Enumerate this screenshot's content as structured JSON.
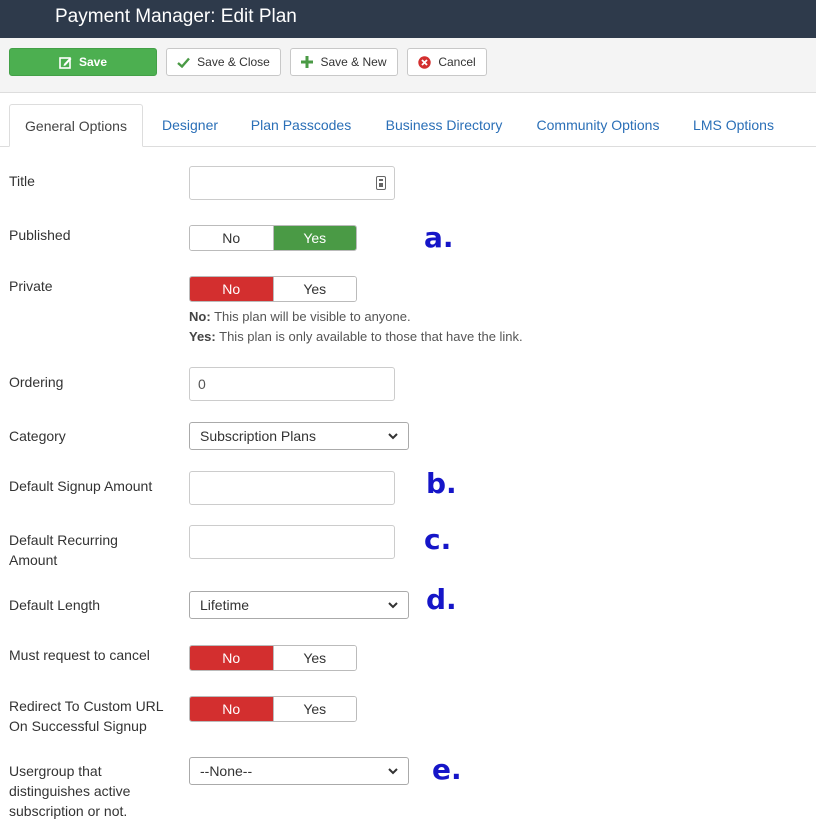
{
  "header": {
    "title": "Payment Manager: Edit Plan"
  },
  "toolbar": {
    "save": "Save",
    "save_close": "Save & Close",
    "save_new": "Save & New",
    "cancel": "Cancel"
  },
  "tabs": [
    "General Options",
    "Designer",
    "Plan Passcodes",
    "Business Directory",
    "Community Options",
    "LMS Options"
  ],
  "form": {
    "title": {
      "label": "Title",
      "value": ""
    },
    "published": {
      "label": "Published",
      "no": "No",
      "yes": "Yes",
      "selected": "Yes"
    },
    "private": {
      "label": "Private",
      "no": "No",
      "yes": "Yes",
      "selected": "No",
      "help_no_key": "No:",
      "help_no_text": "This plan will be visible to anyone.",
      "help_yes_key": "Yes:",
      "help_yes_text": "This plan is only available to those that have the link."
    },
    "ordering": {
      "label": "Ordering",
      "value": "0"
    },
    "category": {
      "label": "Category",
      "value": "Subscription Plans"
    },
    "signup_amount": {
      "label": "Default Signup Amount",
      "value": ""
    },
    "recurring_amount": {
      "label_line1": "Default Recurring",
      "label_line2": "Amount",
      "value": ""
    },
    "length": {
      "label": "Default Length",
      "value": "Lifetime"
    },
    "must_request_cancel": {
      "label": "Must request to cancel",
      "no": "No",
      "yes": "Yes",
      "selected": "No"
    },
    "redirect_custom_url": {
      "label_line1": "Redirect To Custom URL",
      "label_line2": "On Successful Signup",
      "no": "No",
      "yes": "Yes",
      "selected": "No"
    },
    "usergroup": {
      "label_line1": "Usergroup that",
      "label_line2": "distinguishes active",
      "label_line3": "subscription or not.",
      "value": "--None--"
    }
  },
  "annotations": {
    "a": "a.",
    "b": "b.",
    "c": "c.",
    "d": "d.",
    "e": "e."
  },
  "colors": {
    "header_bg": "#2e3a4b",
    "save_green": "#4caf50",
    "toggle_green": "#4a9a45",
    "toggle_red": "#d32f2f",
    "link_blue": "#2a6fb7",
    "annotation_blue": "#1515c8"
  }
}
